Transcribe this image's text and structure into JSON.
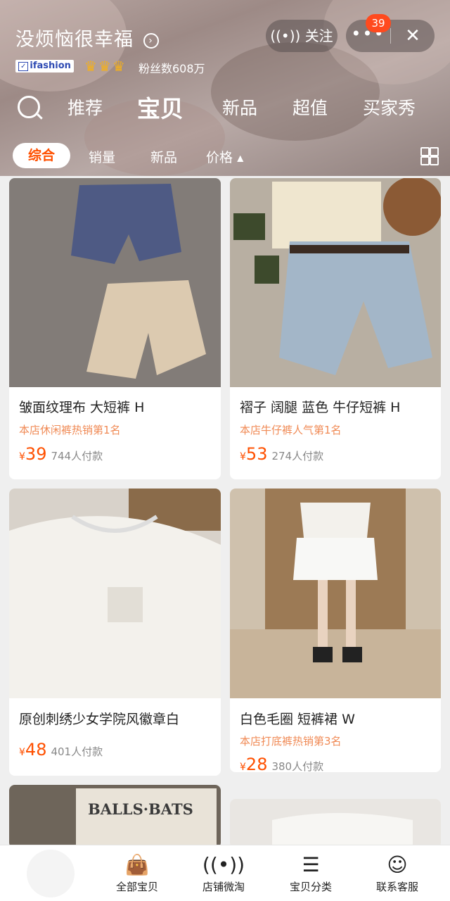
{
  "shop": {
    "name": "没烦恼很幸福",
    "badge_text": "ifashion",
    "fans": "粉丝数608万",
    "follow_label": "关注",
    "notif_count": "39"
  },
  "nav": {
    "tabs": [
      "推荐",
      "宝贝",
      "新品",
      "超值",
      "买家秀"
    ],
    "active": "宝贝"
  },
  "filter": {
    "items": [
      "综合",
      "销量",
      "新品",
      "价格"
    ],
    "active": "综合"
  },
  "products": [
    {
      "title": "皱面纹理布 大短裤 H",
      "rank": "本店休闲裤热销第1名",
      "currency": "¥",
      "price": "39",
      "paid": "744人付款"
    },
    {
      "title": "褶子 阔腿 蓝色 牛仔短裤 H",
      "rank": "本店牛仔裤人气第1名",
      "currency": "¥",
      "price": "53",
      "paid": "274人付款"
    },
    {
      "title": "原创刺绣少女学院风徽章白",
      "rank": "",
      "currency": "¥",
      "price": "48",
      "paid": "401人付款"
    },
    {
      "title": "白色毛圈 短裤裙 W",
      "rank": "本店打底裤热销第3名",
      "currency": "¥",
      "price": "28",
      "paid": "380人付款"
    }
  ],
  "partial_card_text": "BALLS·BATS",
  "bottom": {
    "items": [
      "全部宝贝",
      "店铺微淘",
      "宝贝分类",
      "联系客服"
    ]
  },
  "colors": {
    "accent": "#ff5000",
    "rank": "#f08a55"
  }
}
